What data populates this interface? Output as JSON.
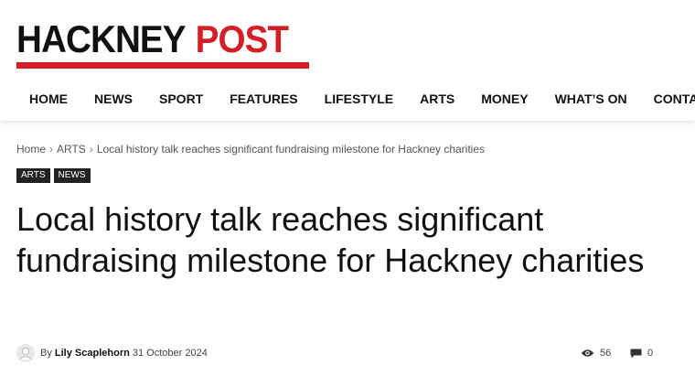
{
  "site": {
    "logo_word1": "HACKNEY",
    "logo_word2": "POST",
    "brand_color": "#d32027"
  },
  "nav": {
    "items": [
      "HOME",
      "NEWS",
      "SPORT",
      "FEATURES",
      "LIFESTYLE",
      "ARTS",
      "MONEY",
      "WHAT’S ON",
      "CONTACT"
    ]
  },
  "breadcrumb": {
    "items": [
      "Home",
      "ARTS",
      "Local history talk reaches significant fundraising milestone for Hackney charities"
    ],
    "separator": "›"
  },
  "tags": [
    "ARTS",
    "NEWS"
  ],
  "article": {
    "title": "Local history talk reaches significant fundraising milestone for Hackney charities",
    "by_label": "By",
    "author": "Lily Scaplehorn",
    "date": "31 October 2024",
    "views": "56",
    "comments": "0"
  },
  "icons": {
    "avatar": "user-avatar-icon",
    "views": "eye-icon",
    "comments": "comment-icon"
  }
}
